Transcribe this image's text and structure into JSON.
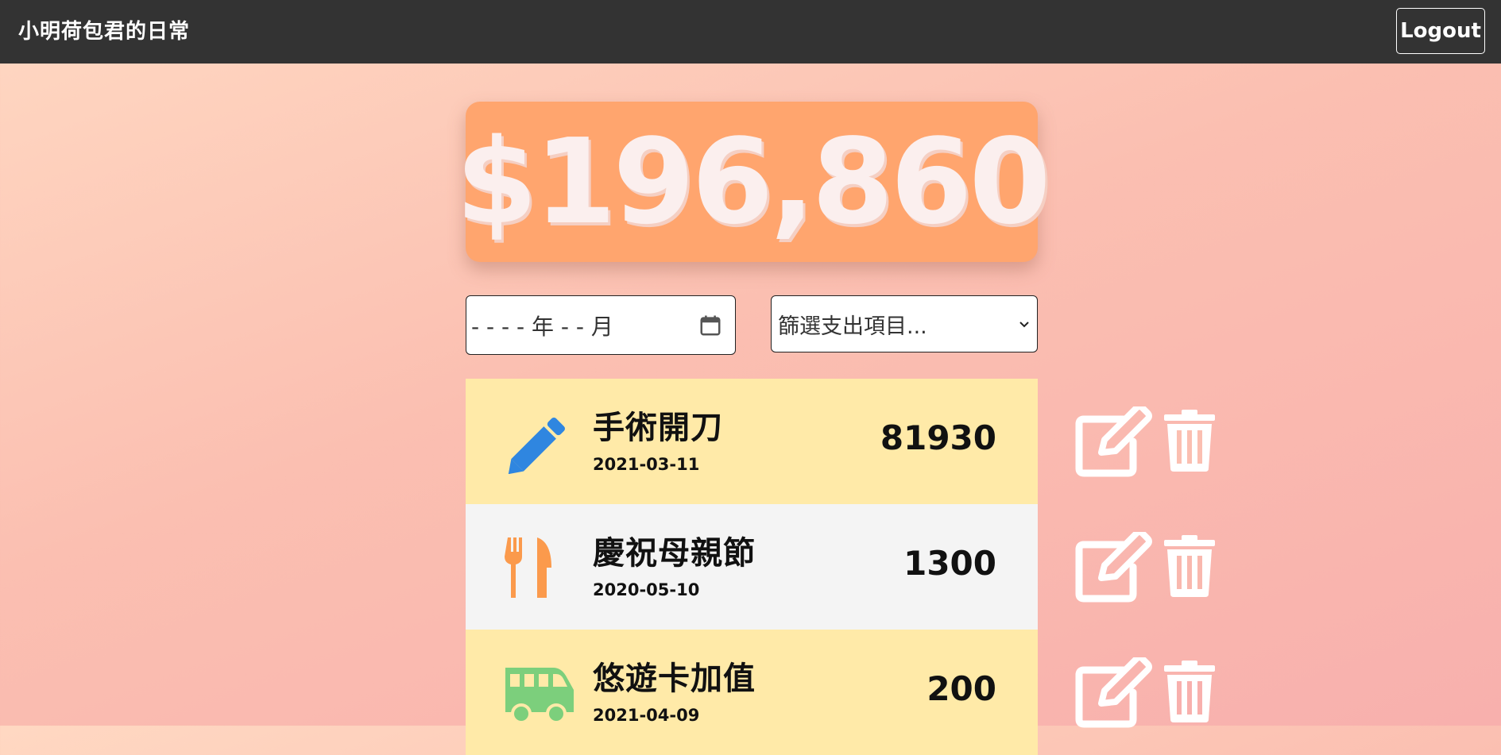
{
  "navbar": {
    "brand": "小明荷包君的日常",
    "logout_label": "Logout"
  },
  "summary": {
    "total": "$196,860",
    "text_color": "#fbefee",
    "card_color": "#ffa56e"
  },
  "filters": {
    "month_placeholder": "- - - - 年 - - 月",
    "category_placeholder": "篩選支出項目..."
  },
  "records": [
    {
      "title": "手術開刀",
      "date": "2021-03-11",
      "amount": "81930",
      "icon": "pencil-icon",
      "icon_color": "#2f86e0",
      "row_color": "#ffeaa8"
    },
    {
      "title": "慶祝母親節",
      "date": "2020-05-10",
      "amount": "1300",
      "icon": "utensils-icon",
      "icon_color": "#fb9a4c",
      "row_color": "#f4f4f4"
    },
    {
      "title": "悠遊卡加值",
      "date": "2021-04-09",
      "amount": "200",
      "icon": "shuttle-van-icon",
      "icon_color": "#7ccf7c",
      "row_color": "#ffeaa8"
    }
  ]
}
